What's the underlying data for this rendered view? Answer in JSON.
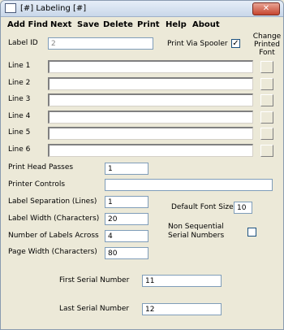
{
  "window": {
    "title": "[#] Labeling [#]",
    "close_label": "✕"
  },
  "menu": [
    "Add Find",
    "Next",
    "Save",
    "Delete",
    "Print",
    "Help",
    "About"
  ],
  "label_id": {
    "label": "Label ID",
    "value": "2"
  },
  "print_spooler": {
    "label": "Print Via Spooler",
    "checked": "✓"
  },
  "change_font": {
    "label": "Change Printed Font"
  },
  "lines": [
    {
      "label": "Line 1"
    },
    {
      "label": "Line 2"
    },
    {
      "label": "Line 3"
    },
    {
      "label": "Line 4"
    },
    {
      "label": "Line 5"
    },
    {
      "label": "Line 6"
    }
  ],
  "print_head_passes": {
    "label": "Print Head Passes",
    "value": "1"
  },
  "printer_controls": {
    "label": "Printer Controls",
    "value": ""
  },
  "label_separation": {
    "label": "Label Separation (Lines)",
    "value": "1"
  },
  "default_font_size": {
    "label": "Default Font Size",
    "value": "10"
  },
  "label_width": {
    "label": "Label Width (Characters)",
    "value": "20"
  },
  "non_sequential": {
    "label": "Non Sequential Serial Numbers",
    "checked": ""
  },
  "labels_across": {
    "label": "Number of Labels Across",
    "value": "4"
  },
  "page_width": {
    "label": "Page Width (Characters)",
    "value": "80"
  },
  "first_serial": {
    "label": "First Serial Number",
    "value": "11"
  },
  "last_serial": {
    "label": "Last Serial Number",
    "value": "12"
  }
}
